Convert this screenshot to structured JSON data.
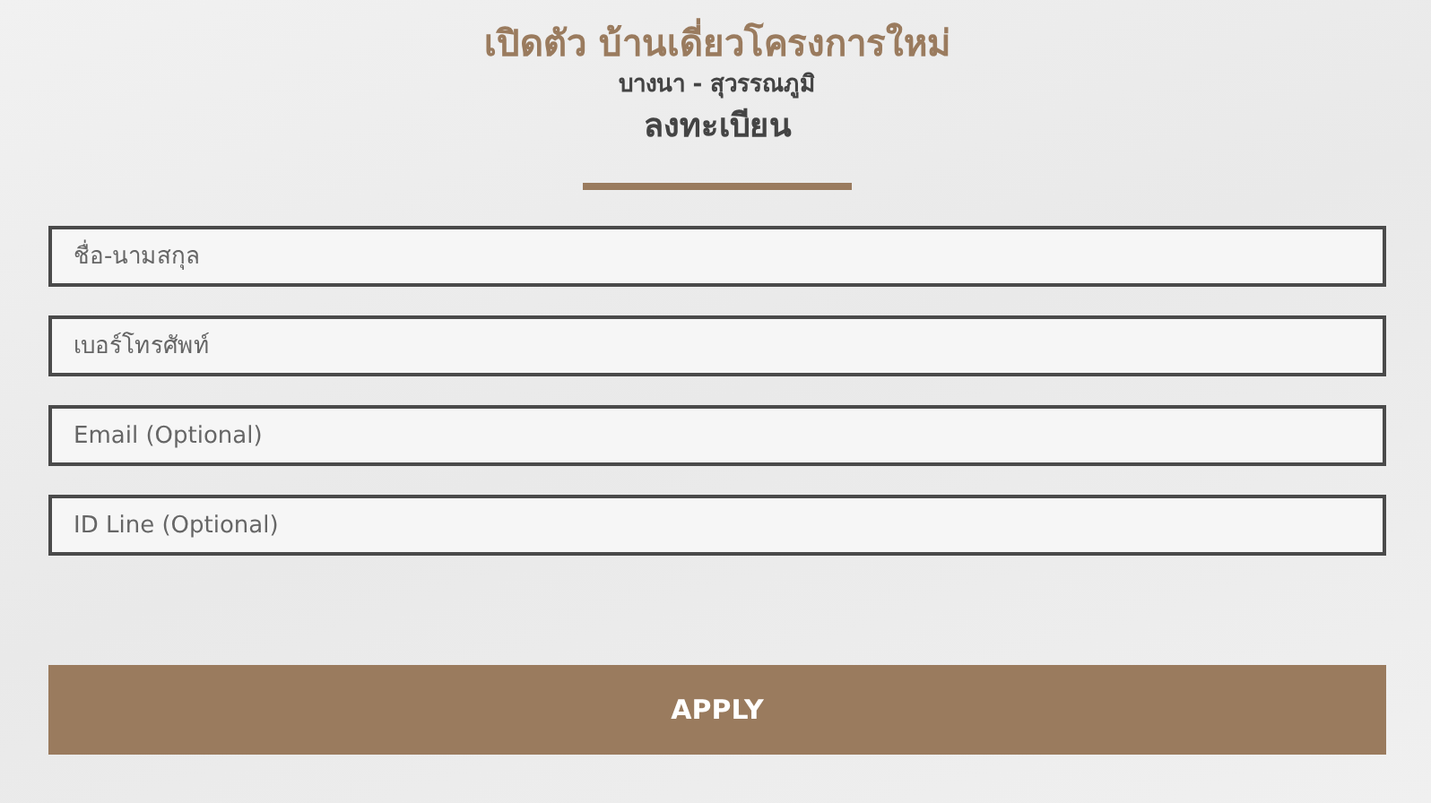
{
  "header": {
    "title": "เปิดตัว บ้านเดี่ยวโครงการใหม่",
    "subtitle": "บางนา - สุวรรณภูมิ",
    "heading": "ลงทะเบียน"
  },
  "fields": [
    {
      "placeholder": "ชื่อ-นามสกุล"
    },
    {
      "placeholder": "เบอร์โทรศัพท์"
    },
    {
      "placeholder": "Email (Optional)"
    },
    {
      "placeholder": "ID Line (Optional)"
    }
  ],
  "submit": {
    "label": "APPLY"
  }
}
